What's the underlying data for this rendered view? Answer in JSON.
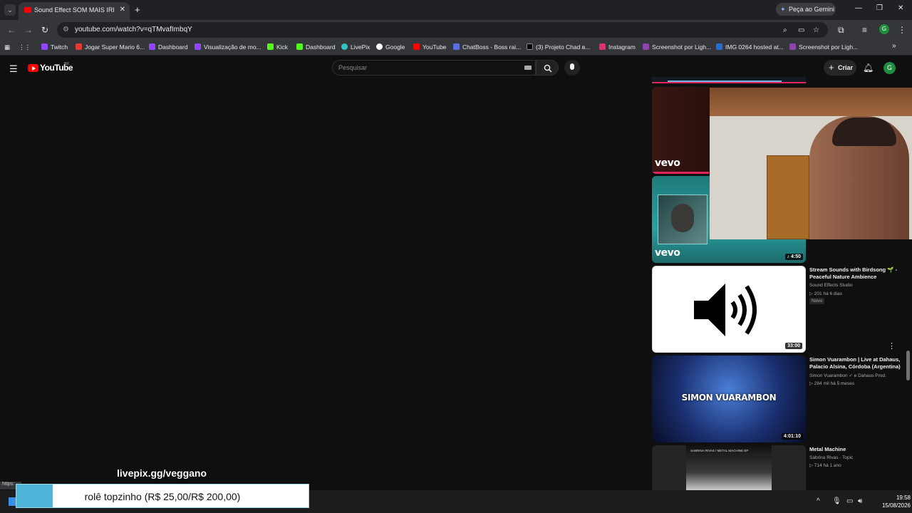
{
  "browser": {
    "tab_title": "Sound Effect SOM MAIS IRRITANTE",
    "url": "youtube.com/watch?v=qTMvafImbqY",
    "gemini_label": "Peça ao Gemini",
    "profile_letter": "G",
    "bookmarks": [
      {
        "label": "Twitch",
        "color": "#9146ff"
      },
      {
        "label": "Jogar Super Mario 6...",
        "color": "#e53935"
      },
      {
        "label": "Dashboard",
        "color": "#9146ff"
      },
      {
        "label": "Visualização de mo...",
        "color": "#9146ff"
      },
      {
        "label": "Kick",
        "color": "#53fc18"
      },
      {
        "label": "Dashboard",
        "color": "#53fc18"
      },
      {
        "label": "LivePix",
        "color": "#2ec5c5"
      },
      {
        "label": "Google",
        "color": "#ffffff"
      },
      {
        "label": "YouTube",
        "color": "#ff0000"
      },
      {
        "label": "ChatBoss - Boss rai...",
        "color": "#5b6ee1"
      },
      {
        "label": "(3) Projeto Chad в...",
        "color": "#000000"
      },
      {
        "label": "Instagram",
        "color": "#e1306c"
      },
      {
        "label": "Screenshot por Ligh...",
        "color": "#8e44ad"
      },
      {
        "label": "IMG 0264 hosted at...",
        "color": "#1e6fd9"
      },
      {
        "label": "Screenshot por Ligh...",
        "color": "#8e44ad"
      }
    ]
  },
  "youtube": {
    "logo_text": "YouTube",
    "country_code": "BR",
    "search_placeholder": "Pesquisar",
    "create_label": "Criar",
    "avatar_letter": "G"
  },
  "sidebar_videos": [
    {
      "title": "Stream Sounds with Birdsong 🌱 - Peaceful Nature Ambience",
      "channel": "Sound Effects Studio",
      "meta": "▷ 201   há 6 dias",
      "badge": "Novo",
      "duration": "33:00"
    },
    {
      "title": "Simon Vuarambon | Live at Dahaus, Palacio Alsina, Córdoba (Argentina)",
      "channel": "Simon Vuarambon ✓ e Dahaus Prod.",
      "meta": "▷ 284 mil   há 5 meses",
      "duration": "4:01:10",
      "thumb_text": "SIMON VUARAMBON"
    },
    {
      "title": "Metal Machine",
      "channel": "Sabrina Rivas - Topic",
      "meta": "▷ 714   há 1 ano",
      "thumb_text": "SABRINA RIVAS / METAL MACHINE EP"
    }
  ],
  "vevo_thumbs": [
    {
      "label": "vevo"
    },
    {
      "label": "vevo",
      "duration": "♪ 4:50"
    }
  ],
  "overlay": {
    "livepix_url": "livepix.gg/veggano",
    "goal_text": "rolê topzinho (R$ 25,00/R$ 200,00)",
    "goal_progress": 0.125,
    "status_url": "https:"
  },
  "taskbar": {
    "time": "19:58",
    "date": "15/08/2026"
  }
}
